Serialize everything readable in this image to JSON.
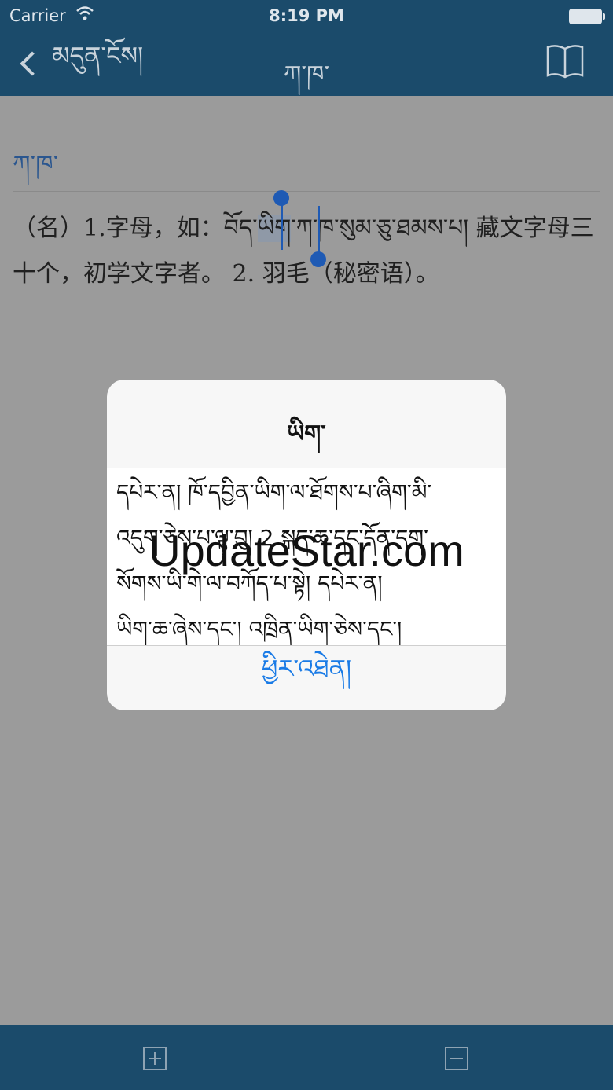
{
  "status": {
    "carrier": "Carrier",
    "time": "8:19 PM"
  },
  "nav": {
    "back_label": "མདུན་ངོས།",
    "title": "ཀ་ཁ་"
  },
  "entry": {
    "headword": "ཀ་ཁ་",
    "definition_part1": "（名）1.字母，如：",
    "definition_tibetan_before": "བོད་",
    "definition_selected": "ཡིག",
    "definition_tibetan_after": "་ཀ་ཁ་སུམ་ཅུ་ཐམས་པ།",
    "definition_part2": " 藏文字母三十个，初学文字者。 2. 羽毛（秘密语）。"
  },
  "alert": {
    "title": "ཡིག་",
    "lines": [
      "དཔེར་ན། ཁོ་དབྱིན་ཡིག་ལ་ཐོགས་པ་ཞིག་མི་",
      "འདུག་ཅེས་པ་ལྟ་བུ། 2 སྐད་ཆ་དང་དོན་དག་",
      "སོགས་ཡི་གེ་ལ་བཀོད་པ་སྟེ།      དཔེར་ན།",
      "ཡིག་ཆ་ཞེས་དང་། འཁྲིན་ཡིག་ཅེས་དང་།"
    ],
    "button_label": "ཕྱིར་འཐེན།"
  },
  "watermark": "UpdateStar.com",
  "toolbar": {
    "zoom_in": "plus-icon",
    "zoom_out": "minus-icon"
  }
}
